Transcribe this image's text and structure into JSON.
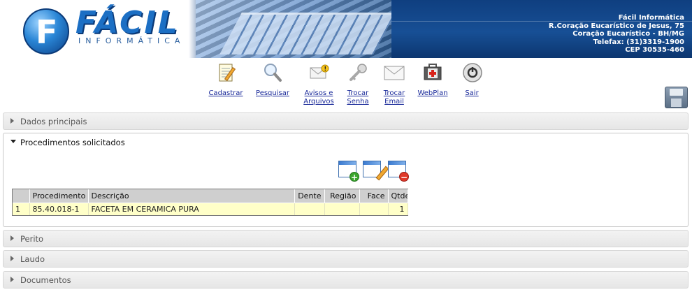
{
  "header": {
    "logo_word": "FÁCIL",
    "logo_sub": "INFORMÁTICA",
    "company": {
      "name": "Fácil Informática",
      "address": "R.Coração Eucarístico de Jesus, 75",
      "district": "Coração Eucarístico - BH/MG",
      "phone": "Telefax: (31)3319-1900",
      "cep": "CEP 30535-460"
    }
  },
  "toolbar": {
    "items": [
      {
        "label": "Cadastrar",
        "icon": "notepad-icon"
      },
      {
        "label": "Pesquisar",
        "icon": "magnifier-icon"
      },
      {
        "label": "Avisos e\nArquivos",
        "icon": "mail-warning-icon"
      },
      {
        "label": "Trocar\nSenha",
        "icon": "key-icon"
      },
      {
        "label": "Trocar\nEmail",
        "icon": "envelope-icon"
      },
      {
        "label": "WebPlan",
        "icon": "first-aid-kit-icon"
      },
      {
        "label": "Sair",
        "icon": "power-icon"
      }
    ],
    "save_icon": "floppy-disk-icon"
  },
  "panels": {
    "dados": {
      "title": "Dados principais",
      "expanded": false
    },
    "procedimentos": {
      "title": "Procedimentos solicitados",
      "expanded": true
    },
    "perito": {
      "title": "Perito",
      "expanded": false
    },
    "laudo": {
      "title": "Laudo",
      "expanded": false
    },
    "documentos": {
      "title": "Documentos",
      "expanded": false
    }
  },
  "actions": {
    "add": "window-add-icon",
    "edit": "window-edit-icon",
    "remove": "window-remove-icon"
  },
  "table": {
    "columns": [
      "",
      "Procedimento",
      "Descrição",
      "Dente",
      "Região",
      "Face",
      "Qtde."
    ],
    "rows": [
      {
        "num": "1",
        "procedimento": "85.40.018-1",
        "descricao": "FACETA EM CERAMICA PURA",
        "dente": "",
        "regiao": "",
        "face": "",
        "qtde": "1"
      }
    ]
  },
  "colors": {
    "banner_blue": "#0d3a78",
    "link_blue": "#1a2a9a",
    "row_highlight": "#ffffc8",
    "header_grey": "#cfcfcf"
  }
}
